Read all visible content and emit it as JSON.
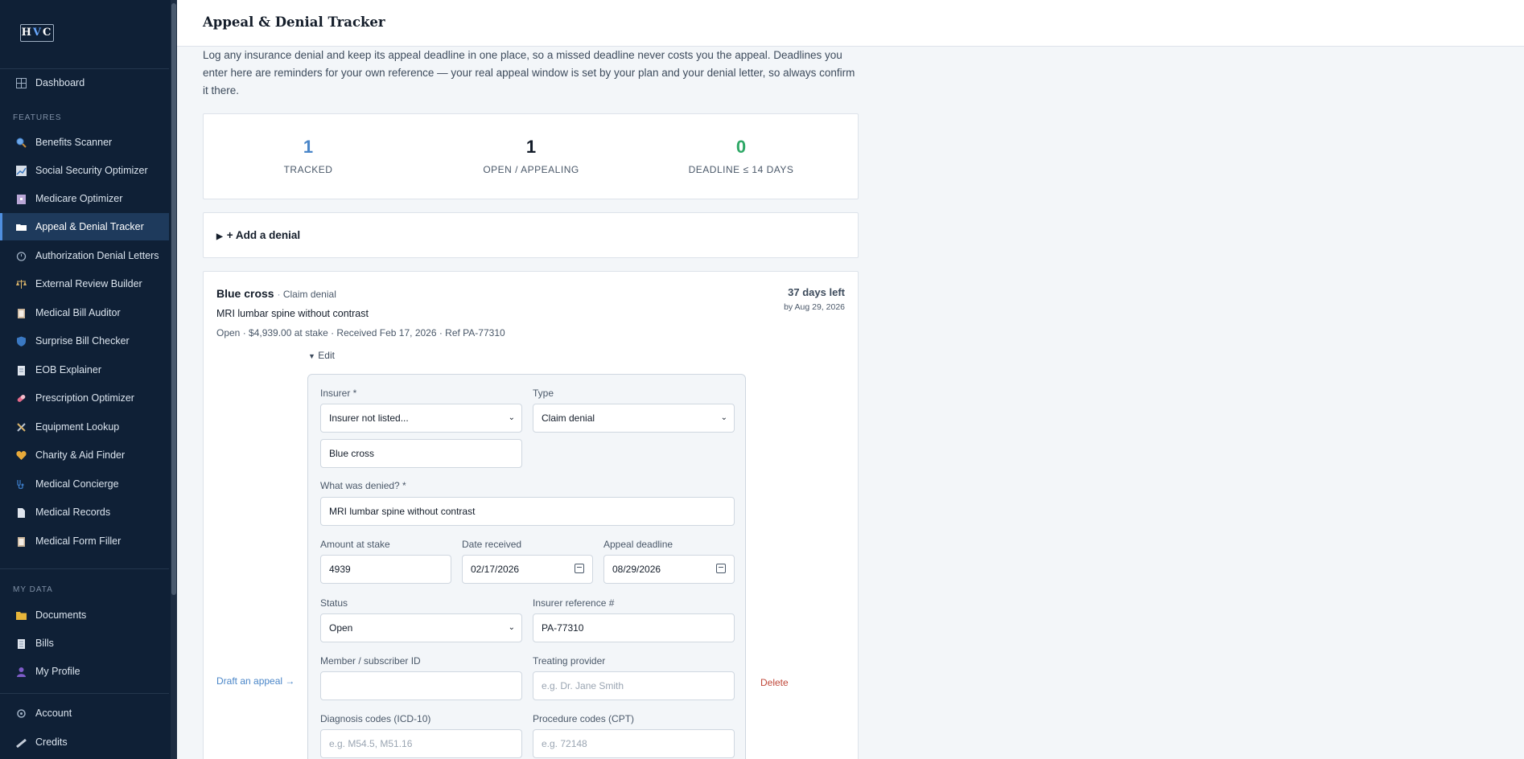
{
  "app": {
    "logo": "HVC"
  },
  "sidebar": {
    "dashboard": "Dashboard",
    "features_label": "FEATURES",
    "features": [
      {
        "label": "Benefits Scanner",
        "icon": "magnifier-icon"
      },
      {
        "label": "Social Security Optimizer",
        "icon": "chart-icon"
      },
      {
        "label": "Medicare Optimizer",
        "icon": "building-icon"
      },
      {
        "label": "Appeal & Denial Tracker",
        "icon": "folder-icon"
      },
      {
        "label": "Authorization Denial Letters",
        "icon": "timer-icon"
      },
      {
        "label": "External Review Builder",
        "icon": "scales-icon"
      },
      {
        "label": "Medical Bill Auditor",
        "icon": "clipboard-icon"
      },
      {
        "label": "Surprise Bill Checker",
        "icon": "shield-icon"
      },
      {
        "label": "EOB Explainer",
        "icon": "document-icon"
      },
      {
        "label": "Prescription Optimizer",
        "icon": "pill-icon"
      },
      {
        "label": "Equipment Lookup",
        "icon": "tools-icon"
      },
      {
        "label": "Charity & Aid Finder",
        "icon": "heart-icon"
      },
      {
        "label": "Medical Concierge",
        "icon": "stethoscope-icon"
      },
      {
        "label": "Medical Records",
        "icon": "page-icon"
      },
      {
        "label": "Medical Form Filler",
        "icon": "form-icon"
      }
    ],
    "mydata_label": "MY DATA",
    "mydata": [
      {
        "label": "Documents",
        "icon": "folder-yellow-icon"
      },
      {
        "label": "Bills",
        "icon": "receipt-icon"
      },
      {
        "label": "My Profile",
        "icon": "person-icon"
      }
    ],
    "account": "Account",
    "credits": "Credits"
  },
  "header": {
    "title": "Appeal & Denial Tracker"
  },
  "intro": "Log any insurance denial and keep its appeal deadline in one place, so a missed deadline never costs you the appeal. Deadlines you enter here are reminders for your own reference — your real appeal window is set by your plan and your denial letter, so always confirm it there.",
  "stats": [
    {
      "value": "1",
      "label": "TRACKED",
      "color": "#4a86c8"
    },
    {
      "value": "1",
      "label": "OPEN / APPEALING",
      "color": "#141d2a"
    },
    {
      "value": "0",
      "label": "DEADLINE ≤ 14 DAYS",
      "color": "#2ea866"
    }
  ],
  "add_denial": "+ Add a denial",
  "denial": {
    "insurer": "Blue cross",
    "type": "Claim denial",
    "item": "MRI lumbar spine without contrast",
    "meta": "Open · $4,939.00 at stake · Received Feb 17, 2026 · Ref PA-77310",
    "days_left": "37 days left",
    "by_date": "by Aug 29, 2026",
    "edit": "Edit",
    "draft_link": "Draft an appeal →",
    "delete": "Delete"
  },
  "form": {
    "insurer_label": "Insurer *",
    "insurer_select": "Insurer not listed...",
    "type_label": "Type",
    "type_select": "Claim denial",
    "insurer_custom": "Blue cross",
    "denied_label": "What was denied? *",
    "denied_value": "MRI lumbar spine without contrast",
    "amount_label": "Amount at stake",
    "amount_value": "4939",
    "received_label": "Date received",
    "received_value": "02/17/2026",
    "deadline_label": "Appeal deadline",
    "deadline_value": "08/29/2026",
    "status_label": "Status",
    "status_select": "Open",
    "ref_label": "Insurer reference #",
    "ref_value": "PA-77310",
    "member_label": "Member / subscriber ID",
    "member_value": "",
    "provider_label": "Treating provider",
    "provider_placeholder": "e.g. Dr. Jane Smith",
    "dx_label": "Diagnosis codes (ICD-10)",
    "dx_placeholder": "e.g. M54.5, M51.16",
    "cpt_label": "Procedure codes (CPT)",
    "cpt_placeholder": "e.g. 72148"
  }
}
